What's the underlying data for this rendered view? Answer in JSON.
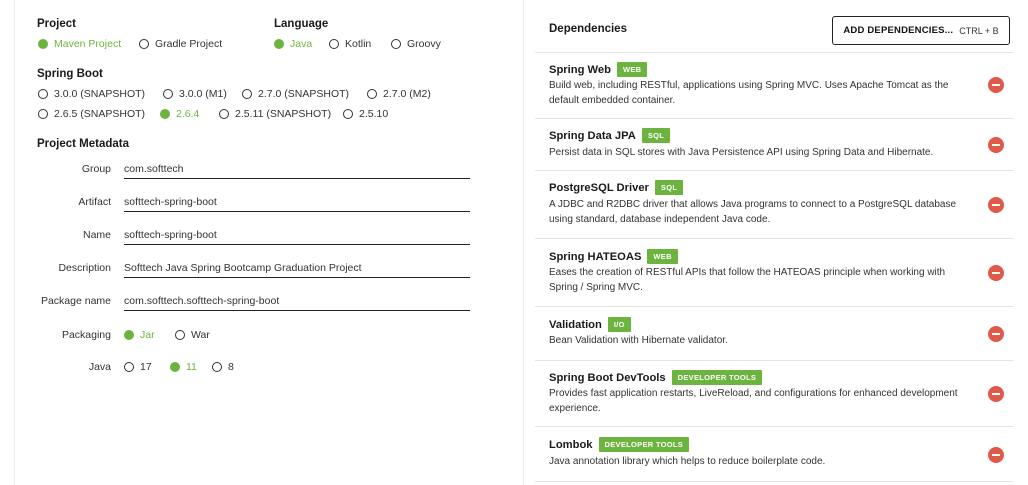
{
  "project": {
    "title": "Project",
    "options": [
      {
        "label": "Maven Project",
        "selected": true
      },
      {
        "label": "Gradle Project",
        "selected": false
      }
    ]
  },
  "language": {
    "title": "Language",
    "options": [
      {
        "label": "Java",
        "selected": true
      },
      {
        "label": "Kotlin",
        "selected": false
      },
      {
        "label": "Groovy",
        "selected": false
      }
    ]
  },
  "spring_boot": {
    "title": "Spring Boot",
    "options": [
      {
        "label": "3.0.0 (SNAPSHOT)",
        "selected": false
      },
      {
        "label": "3.0.0 (M1)",
        "selected": false
      },
      {
        "label": "2.7.0 (SNAPSHOT)",
        "selected": false
      },
      {
        "label": "2.7.0 (M2)",
        "selected": false
      },
      {
        "label": "2.6.5 (SNAPSHOT)",
        "selected": false
      },
      {
        "label": "2.6.4",
        "selected": true
      },
      {
        "label": "2.5.11 (SNAPSHOT)",
        "selected": false
      },
      {
        "label": "2.5.10",
        "selected": false
      }
    ]
  },
  "metadata": {
    "title": "Project Metadata",
    "group": {
      "label": "Group",
      "value": "com.softtech"
    },
    "artifact": {
      "label": "Artifact",
      "value": "softtech-spring-boot"
    },
    "name": {
      "label": "Name",
      "value": "softtech-spring-boot"
    },
    "description": {
      "label": "Description",
      "value": "Softtech Java Spring Bootcamp Graduation Project"
    },
    "package_name": {
      "label": "Package name",
      "value": "com.softtech.softtech-spring-boot"
    },
    "packaging": {
      "label": "Packaging",
      "options": [
        {
          "label": "Jar",
          "selected": true
        },
        {
          "label": "War",
          "selected": false
        }
      ]
    },
    "java": {
      "label": "Java",
      "options": [
        {
          "label": "17",
          "selected": false
        },
        {
          "label": "11",
          "selected": true
        },
        {
          "label": "8",
          "selected": false
        }
      ]
    }
  },
  "dependencies": {
    "title": "Dependencies",
    "add_button": {
      "label": "ADD DEPENDENCIES...",
      "shortcut": "CTRL + B"
    },
    "items": [
      {
        "name": "Spring Web",
        "badge": "WEB",
        "description": "Build web, including RESTful, applications using Spring MVC. Uses Apache Tomcat as the default embedded container."
      },
      {
        "name": "Spring Data JPA",
        "badge": "SQL",
        "description": "Persist data in SQL stores with Java Persistence API using Spring Data and Hibernate."
      },
      {
        "name": "PostgreSQL Driver",
        "badge": "SQL",
        "description": "A JDBC and R2DBC driver that allows Java programs to connect to a PostgreSQL database using standard, database independent Java code."
      },
      {
        "name": "Spring HATEOAS",
        "badge": "WEB",
        "description": "Eases the creation of RESTful APIs that follow the HATEOAS principle when working with Spring / Spring MVC."
      },
      {
        "name": "Validation",
        "badge": "I/O",
        "description": "Bean Validation with Hibernate validator."
      },
      {
        "name": "Spring Boot DevTools",
        "badge": "DEVELOPER TOOLS",
        "description": "Provides fast application restarts, LiveReload, and configurations for enhanced development experience."
      },
      {
        "name": "Lombok",
        "badge": "DEVELOPER TOOLS",
        "description": "Java annotation library which helps to reduce boilerplate code."
      }
    ]
  },
  "colors": {
    "accent": "#6db33f",
    "remove": "#e05a4a"
  }
}
